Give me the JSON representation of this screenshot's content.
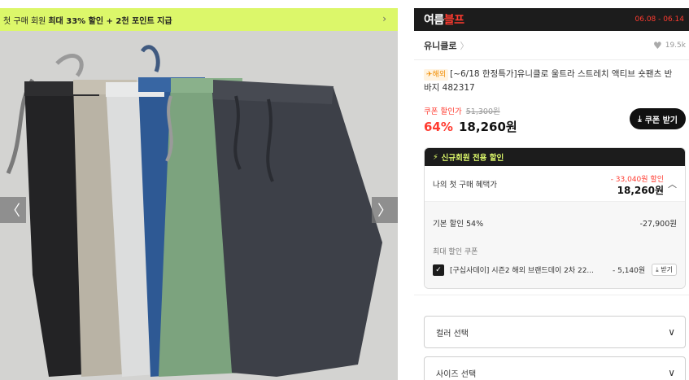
{
  "promo_banner": {
    "prefix": "첫 구매 회원",
    "highlight": "최대 33% 할인 + 2천 포인트 지급",
    "chevron_icon": "chevron-right-icon"
  },
  "gallery": {
    "prev_icon": "chevron-left-icon",
    "next_icon": "chevron-right-icon",
    "prev_glyph": "〈",
    "next_glyph": "〉",
    "shorts_colors": [
      "#2a2a2c",
      "#b8b2a4",
      "#dedfe0",
      "#2f5a96",
      "#7ba27e",
      "#3d4048"
    ]
  },
  "event": {
    "title_a": "여름",
    "title_b": "블프",
    "dates": "06.08 - 06.14"
  },
  "brand": {
    "name": "유니클로",
    "arrow": "〉",
    "likes": "19.5k",
    "heart_icon": "heart-icon"
  },
  "product": {
    "tag": "✈해외",
    "title": "[~6/18 한정특가]유니클로 울트라 스트레치 액티브 숏팬츠 반바지 482317"
  },
  "price": {
    "coupon_label": "쿠폰 할인가",
    "original": "51,300원",
    "discount_rate": "64%",
    "final": "18,260원",
    "coupon_button": "쿠폰 받기",
    "download_icon": "download-icon"
  },
  "benefit": {
    "header": "신규회원 전용 할인",
    "bolt_icon": "lightning-icon",
    "first_purchase_label": "나의 첫 구매 혜택가",
    "first_discount": "- 33,040원 할인",
    "first_price": "18,260원",
    "base_discount_label": "기본 할인 54%",
    "base_discount_value": "-27,900원",
    "max_coupon_label": "최대 할인 쿠폰",
    "coupon_name": "[구십사데이] 시즌2 해외 브랜드데이 2차 22...",
    "coupon_amount": "- 5,140원",
    "coupon_get": "받기"
  },
  "options": {
    "color_placeholder": "컬러 선택",
    "size_placeholder": "사이즈 선택",
    "chevron_icon": "chevron-down-icon"
  },
  "colors": {
    "accent_red": "#ff3b30",
    "banner_lime": "#dcf76a",
    "dark": "#1c1c1c"
  }
}
